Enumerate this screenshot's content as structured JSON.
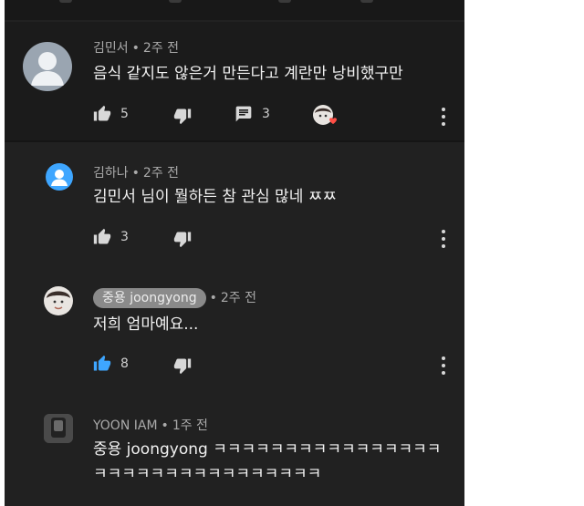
{
  "colors": {
    "background": "#212121",
    "accent_blue": "#3ea6ff",
    "text": "#f1f1f1",
    "muted": "#aaaaaa"
  },
  "main_comment": {
    "author": "김민서",
    "time": "2주 전",
    "text": "음식 같지도 않은거 만든다고 계란만 낭비했구만",
    "likes": "5",
    "replies": "3",
    "hearted_by_creator": true
  },
  "replies": [
    {
      "author": "김하나",
      "time": "2주 전",
      "text": "김민서 님이 뭘하든 참 관심 많네 ㅉㅉ",
      "likes": "3",
      "liked": false
    },
    {
      "author": "중용 joongyong",
      "time": "2주 전",
      "text": "저희 엄마예요...",
      "likes": "8",
      "liked": true,
      "is_channel_owner": true
    },
    {
      "author": "YOON IAM",
      "time": "1주 전",
      "text_line1": "중용 joongyong ㅋㅋㅋㅋㅋㅋㅋㅋㅋㅋㅋㅋㅋㅋㅋㅋ",
      "text_line2": "ㅋㅋㅋㅋㅋㅋㅋㅋㅋㅋㅋㅋㅋㅋㅋㅋ"
    }
  ],
  "icons": [
    "like-icon",
    "dislike-icon",
    "reply-icon",
    "more-options-icon",
    "creator-heart-icon"
  ]
}
